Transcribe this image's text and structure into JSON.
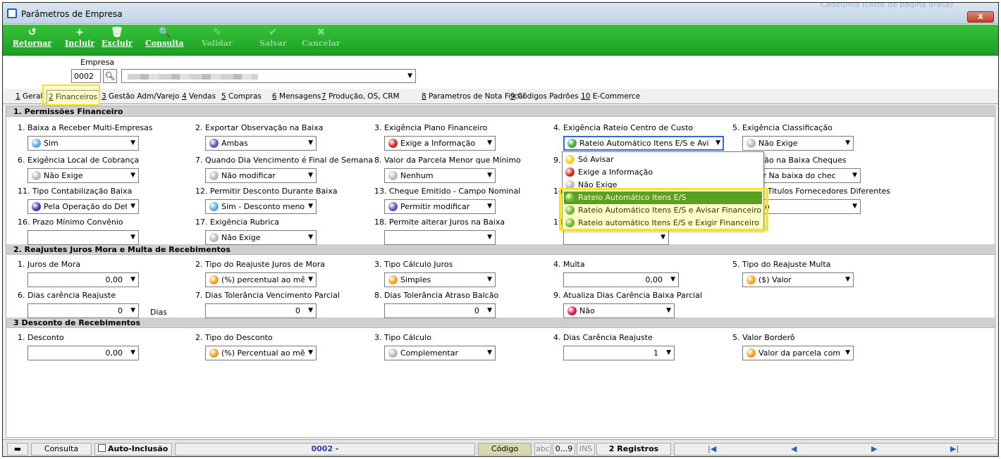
{
  "window": {
    "title": "Parâmetros de Empresa",
    "bg_hint": "Cadeumio (Lotte de pagina arasa)",
    "close": "x"
  },
  "toolbar": [
    {
      "icon": "↺",
      "label": "Retornar",
      "enabled": true
    },
    {
      "icon": "+",
      "label": "Incluir",
      "enabled": true
    },
    {
      "icon": "🗑",
      "label": "Excluir",
      "enabled": true
    },
    {
      "icon": "🔍",
      "label": "Consulta",
      "enabled": true
    },
    {
      "icon": "✎",
      "label": "Validar",
      "enabled": false
    },
    {
      "icon": "✔",
      "label": "Salvar",
      "enabled": false
    },
    {
      "icon": "✖",
      "label": "Cancelar",
      "enabled": false
    }
  ],
  "empresa": {
    "label": "Empresa",
    "code": "0002"
  },
  "tabs": [
    {
      "num": "1",
      "label": " Geral"
    },
    {
      "num": "2",
      "label": " Financeiros",
      "selected": true
    },
    {
      "num": "3",
      "label": " Gestão Adm/Varejo"
    },
    {
      "num": "4",
      "label": " Vendas"
    },
    {
      "num": "5",
      "label": " Compras"
    },
    {
      "num": "6",
      "label": " Mensagens"
    },
    {
      "num": "7",
      "label": " Produção, OS, CRM"
    },
    {
      "num": "8",
      "label": " Parametros de Nota Fiscal"
    },
    {
      "num": "9",
      "label": " Códigos Padrões"
    },
    {
      "num": "10",
      "label": " E-Commerce"
    }
  ],
  "sections": {
    "s1": "1. Permissões Financeiro",
    "s2": "2. Reajustes Juros Mora e Multa de Recebimentos",
    "s3": "3 Desconto de Recebimentos"
  },
  "fields": {
    "f1_1": {
      "label": "1. Baixa a Receber Multi-Empresas",
      "value": "Sim",
      "color": "#5aa7e8"
    },
    "f1_2": {
      "label": "2. Exportar Observação na Baixa",
      "value": "Ambas",
      "color": "#5a54b8"
    },
    "f1_3": {
      "label": "3. Exigência Plano Financeiro",
      "value": "Exige a Informação",
      "color": "#d42222"
    },
    "f1_4": {
      "label": "4. Exigência Rateio Centro de Custo",
      "value": "Rateio Automático Itens E/S e Avi",
      "color": "#3aa83a"
    },
    "f1_5": {
      "label": "5. Exigência Classificação",
      "value": "Não Exige",
      "color": "#b8b8b8"
    },
    "f1_6": {
      "label": "6. Exigência Local de Cobrança",
      "value": "Não Exige",
      "color": "#b8b8b8"
    },
    "f1_7": {
      "label": "7. Quando Dia Vencimento é Final de Semana",
      "value": "Não modificar",
      "color": "#b8b8b8"
    },
    "f1_8": {
      "label": "8. Valor da Parcela Menor que Mínimo",
      "value": "Nenhum",
      "color": "#b8b8b8"
    },
    "f1_9": {
      "label": "9.",
      "value": "",
      "color": ""
    },
    "f1_10": {
      "label": "ração na Baixa Cheques",
      "value": "sar Na baixa do chec",
      "color": ""
    },
    "f1_11": {
      "label": "11. Tipo Contabilização Baixa",
      "value": "Pela Operação do Det",
      "color": "#3a3aa8"
    },
    "f1_12": {
      "label": "12. Permitir Desconto Durante Baixa",
      "value": "Sim - Desconto meno",
      "color": "#5aa7e8"
    },
    "f1_13": {
      "label": "13. Cheque Emitido - Campo Nominal",
      "value": "Permitir modificar",
      "color": "#5a54b8"
    },
    "f1_14": {
      "label": "14.",
      "value": "",
      "color": ""
    },
    "f1_15": {
      "label": "par Titulos Fornecedores Diferentes",
      "value": "Não",
      "color": ""
    },
    "f1_16": {
      "label": "16. Prazo Mínimo Convênio",
      "value": "",
      "color": ""
    },
    "f1_17": {
      "label": "17. Exigência Rubrica",
      "value": "Não Exige",
      "color": "#b8b8b8"
    },
    "f1_18": {
      "label": "18. Permite alterar Juros na Baixa",
      "value": "",
      "color": ""
    },
    "f1_19": {
      "label": "19.",
      "value": "",
      "color": ""
    },
    "f2_1": {
      "label": "1. Juros de Mora",
      "value": "0,00"
    },
    "f2_2": {
      "label": "2. Tipo do Reajuste Juros de Mora",
      "value": "(%) percentual ao mê:",
      "color": "#f0a020"
    },
    "f2_3": {
      "label": "3. Tipo Cálculo Juros",
      "value": "Simples",
      "color": "#f0a020"
    },
    "f2_4": {
      "label": "4. Multa",
      "value": "0,00"
    },
    "f2_5": {
      "label": "5. Tipo do Reajuste Multa",
      "value": "($) Valor",
      "color": "#f0a020"
    },
    "f2_6": {
      "label": "6. Dias carência Reajuste",
      "value": "0",
      "suffix": "Dias"
    },
    "f2_7": {
      "label": "7. Dias Tolerância Vencimento Parcial",
      "value": "0"
    },
    "f2_8": {
      "label": "8. Dias Tolerância Atraso Balcão",
      "value": "0"
    },
    "f2_9": {
      "label": "9. Atualiza Dias Carência Baixa Parcial",
      "value": "Não",
      "color": "#d4145a"
    },
    "f3_1": {
      "label": "1. Desconto",
      "value": "0,00"
    },
    "f3_2": {
      "label": "2. Tipo do Desconto",
      "value": "(%) Percentual ao mê:",
      "color": "#f0a020"
    },
    "f3_3": {
      "label": "3. Tipo Cálculo",
      "value": "Complementar",
      "color": "#b8b8b8"
    },
    "f3_4": {
      "label": "4. Dias Carência Reajuste",
      "value": "1"
    },
    "f3_5": {
      "label": "5. Valor Borderô",
      "value": "Valor da parcela com",
      "color": "#f0a020"
    }
  },
  "dropdown": [
    {
      "label": "Só Avisar",
      "color": "#f0d010"
    },
    {
      "label": "Exige a Informação",
      "color": "#d42222"
    },
    {
      "label": "Não Exige",
      "color": "#b8b8b8"
    },
    {
      "label": "Rateio Automático Itens E/S",
      "color": "#3aa83a",
      "selected": true
    },
    {
      "label": "Rateio Automático Itens E/S e Avisar Financeiro",
      "color": "#3aa83a"
    },
    {
      "label": "Rateio automático Itens E/S e Exigir Financeiro",
      "color": "#3aa83a"
    }
  ],
  "status": {
    "mode": "Consulta",
    "auto": "Auto-Inclusão",
    "record": "0002 -",
    "codigo": "Código",
    "abc": "abc",
    "range": "0...9",
    "ins": "INS",
    "count": "2 Registros"
  }
}
